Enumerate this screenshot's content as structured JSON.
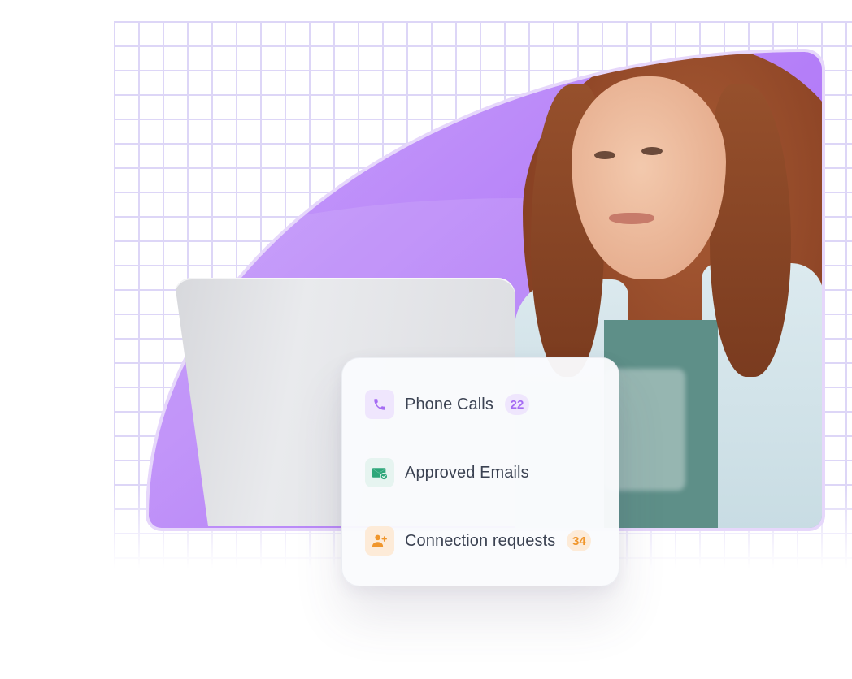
{
  "card": {
    "items": [
      {
        "icon": "phone-icon",
        "label": "Phone Calls",
        "count": "22"
      },
      {
        "icon": "email-check-icon",
        "label": "Approved Emails",
        "count": ""
      },
      {
        "icon": "user-add-icon",
        "label": "Connection requests",
        "count": "34"
      }
    ]
  },
  "colors": {
    "accent_purple": "#b47ef8",
    "badge_purple": "#a56cf3",
    "email_green": "#2ea77a",
    "badge_orange": "#f0962c"
  }
}
